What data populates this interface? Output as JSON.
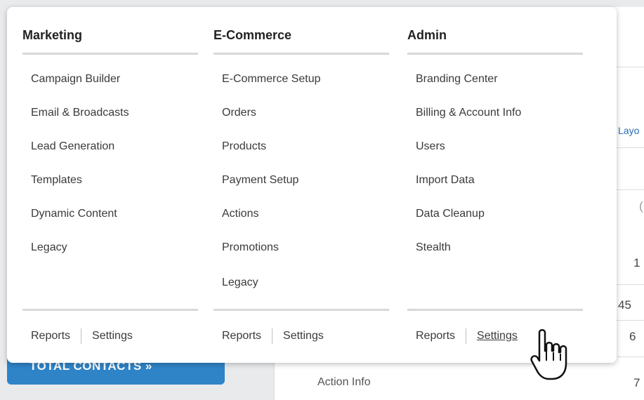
{
  "menu": {
    "columns": [
      {
        "heading": "Marketing",
        "items": [
          "Campaign Builder",
          "Email & Broadcasts",
          "Lead Generation",
          "Templates",
          "Dynamic Content",
          "Legacy"
        ],
        "footer": {
          "reports": "Reports",
          "settings": "Settings"
        }
      },
      {
        "heading": "E-Commerce",
        "items": [
          "E-Commerce Setup",
          "Orders",
          "Products",
          "Payment Setup",
          "Actions",
          "Promotions",
          "Legacy"
        ],
        "footer": {
          "reports": "Reports",
          "settings": "Settings"
        }
      },
      {
        "heading": "Admin",
        "items": [
          "Branding Center",
          "Billing & Account Info",
          "Users",
          "Import Data",
          "Data Cleanup",
          "Stealth"
        ],
        "footer": {
          "reports": "Reports",
          "settings": "Settings"
        }
      }
    ]
  },
  "background": {
    "total_contacts_button": "TOTAL CONTACTS »",
    "layout_link": "Layo",
    "row_values": [
      "1",
      "45",
      "6",
      "7"
    ],
    "partial_text_c": "(",
    "bottom_text": "Action Info"
  }
}
